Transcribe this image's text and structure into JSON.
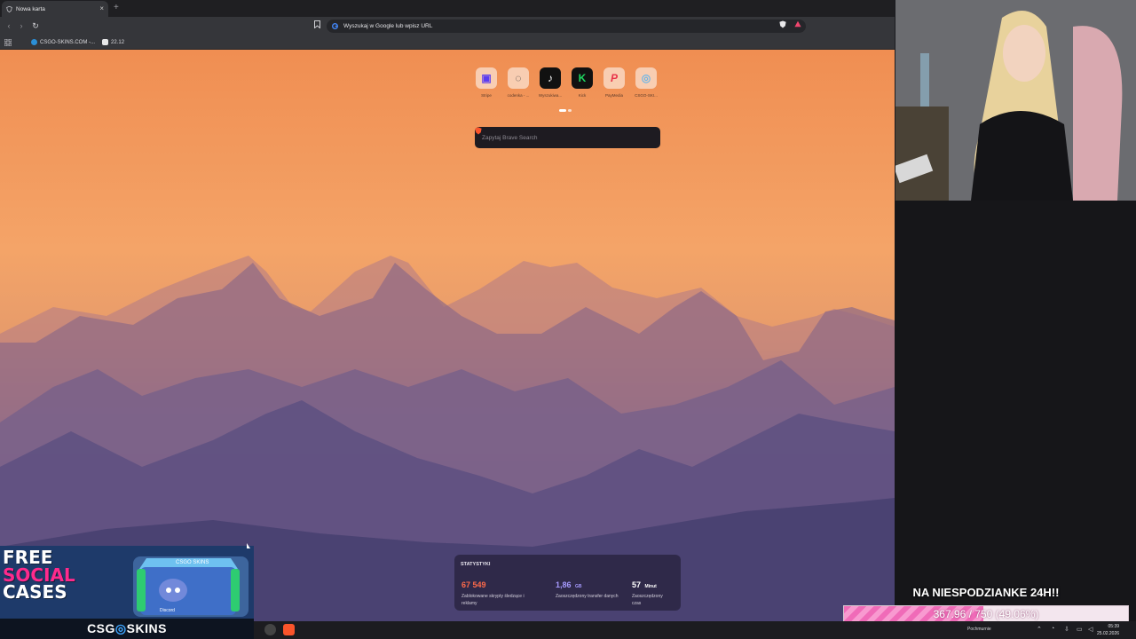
{
  "browser": {
    "tab": {
      "title": "Nowa karta",
      "close": "×",
      "new_tab": "+"
    },
    "toolbar": {
      "back": "‹",
      "forward": "›",
      "reload": "↻",
      "address_placeholder": "Wyszukaj w Google lub wpisz URL"
    },
    "bookmarks": [
      {
        "label": "CSGO-SKINS.COM -...",
        "icon": "csgo-skins-icon",
        "color": "#2b8fd6"
      },
      {
        "label": "22.12",
        "icon": "bookmark-page-icon",
        "color": "#e8e8e8"
      }
    ]
  },
  "ntp": {
    "tiles": [
      {
        "label": "Stripe",
        "icon": "stripe-icon",
        "glyph": "▣",
        "color": "#5b3cf0"
      },
      {
        "label": "codenka - ...",
        "icon": "codenka-icon",
        "glyph": "◌",
        "color": "#ffffff"
      },
      {
        "label": "Wyszukiwa...",
        "icon": "tiktok-icon",
        "glyph": "♪",
        "color": "#111111"
      },
      {
        "label": "Kick",
        "icon": "kick-icon",
        "glyph": "K",
        "color": "#1ed760"
      },
      {
        "label": "PayMedia",
        "icon": "paymedia-icon",
        "glyph": "P",
        "color": "#e8344a"
      },
      {
        "label": "CSGO-SKI...",
        "icon": "csgo-skins-icon",
        "glyph": "◎",
        "color": "#6fb6e6"
      }
    ],
    "search_placeholder": "Zapytaj Brave Search",
    "stats": {
      "title": "STATYSTYKI",
      "items": [
        {
          "value": "67 549",
          "unit": "",
          "color": "#ff6a4a",
          "desc": "Zablokowane skrypty śledzące i reklamy"
        },
        {
          "value": "1,86",
          "unit": "GB",
          "color": "#a79bff",
          "desc": "Zaoszczędzony transfer danych"
        },
        {
          "value": "57",
          "unit": "Minut",
          "color": "#ffffff",
          "desc": "Zaoszczędzony czas"
        }
      ]
    }
  },
  "overlay": {
    "goal_title": "NA NIESPODZIANKE 24H!!",
    "goal_text": "367.96 / 750 (49.06%)",
    "goal_progress": 0.4906,
    "promo": {
      "line1": "FREE",
      "line2": "SOCIAL",
      "line3": "CASES",
      "box_brand": "CSGO SKINS",
      "box_discord": "Discord",
      "brand_left": "CSG",
      "brand_right": "SKINS"
    }
  },
  "taskbar": {
    "weather": "Pochmurnie",
    "time": "05:39",
    "date": "25.02.2026"
  }
}
